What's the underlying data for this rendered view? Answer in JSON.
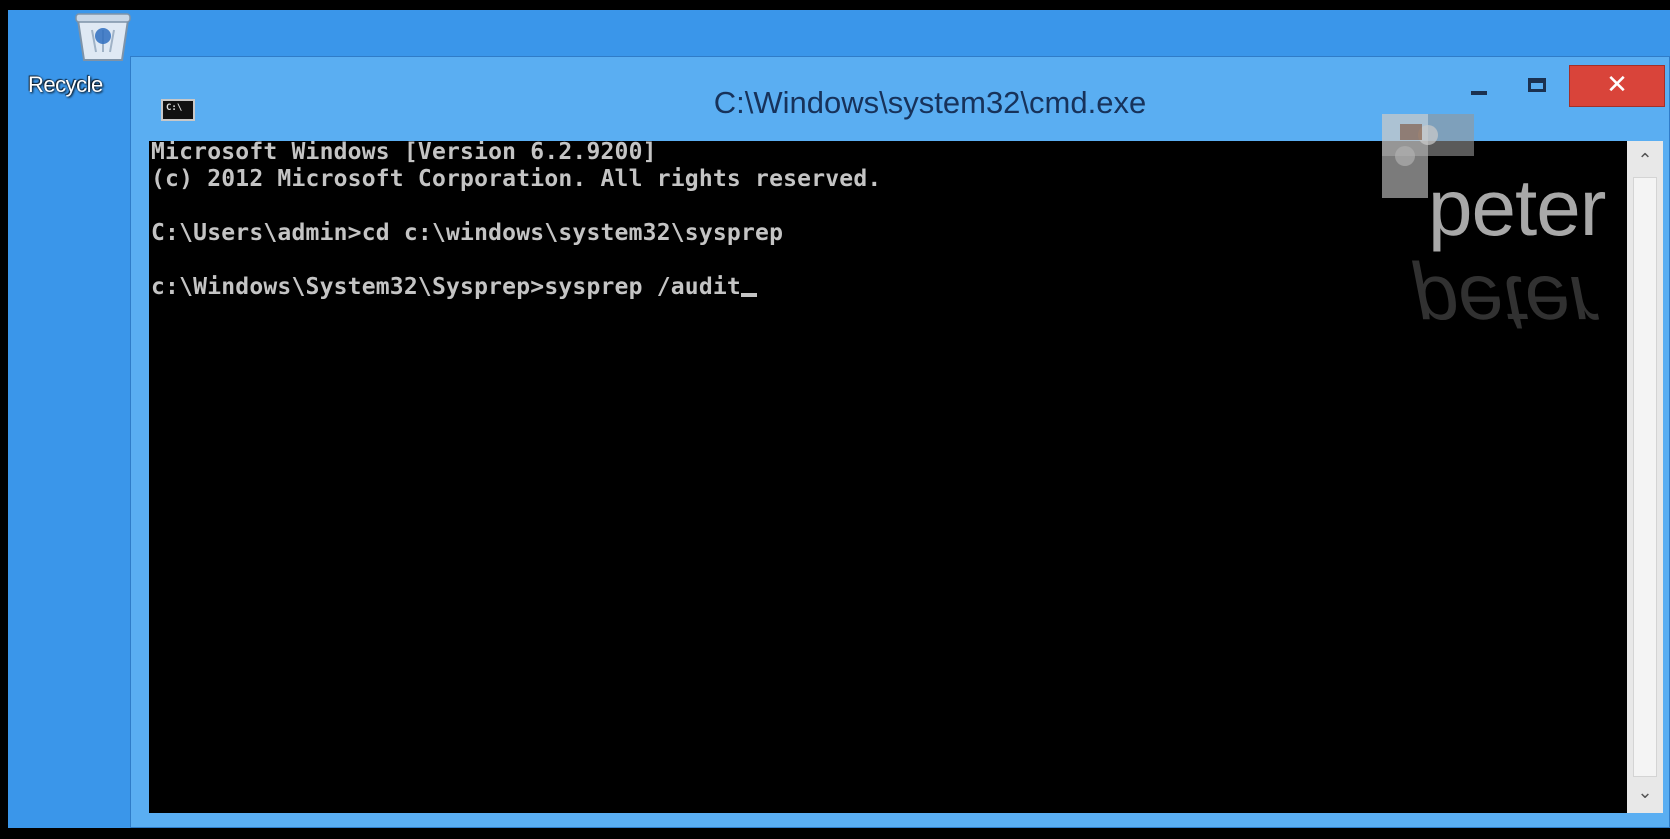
{
  "desktop": {
    "recycle_bin_label": "Recycle",
    "recycle_bin_icon": "recycle-bin-icon"
  },
  "window": {
    "title": "C:\\Windows\\system32\\cmd.exe",
    "app_icon_text": "C:\\",
    "controls": {
      "minimize_icon": "minimize-icon",
      "maximize_icon": "maximize-icon",
      "close_label": "✕"
    }
  },
  "console": {
    "lines": [
      "Microsoft Windows [Version 6.2.9200]",
      "(c) 2012 Microsoft Corporation. All rights reserved.",
      "",
      "C:\\Users\\admin>cd c:\\windows\\system32\\sysprep",
      "",
      "c:\\Windows\\System32\\Sysprep>sysprep /audit"
    ]
  },
  "scrollbar": {
    "up_arrow": "⌃",
    "down_arrow": "⌄"
  },
  "watermark": {
    "text": "peter",
    "reflection_text": "peter"
  },
  "colors": {
    "desktop": "#3a96ea",
    "window_frame": "#5aaef2",
    "console_bg": "#000000",
    "console_text": "#c4c4c4",
    "close_button": "#d9443a"
  }
}
